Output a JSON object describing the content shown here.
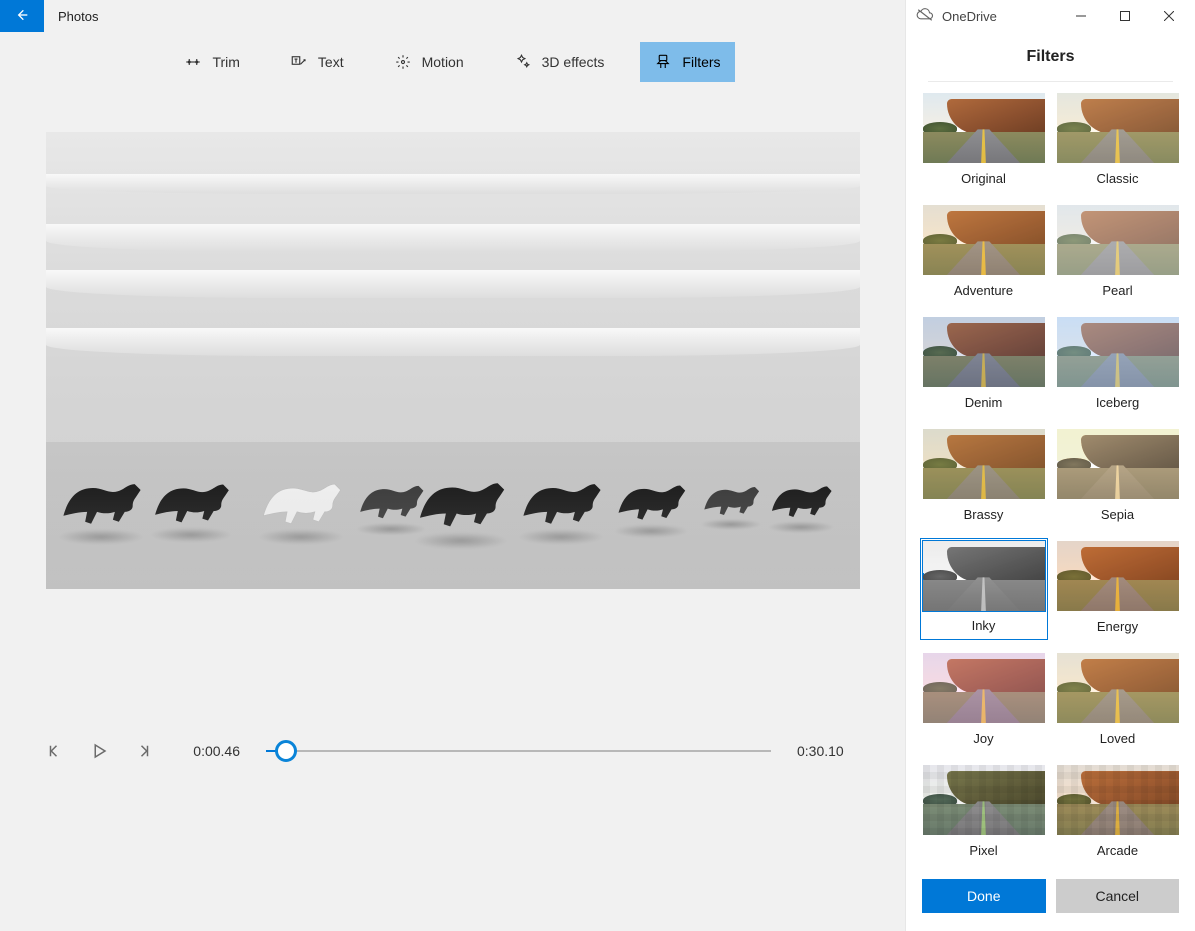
{
  "app": {
    "title": "Photos"
  },
  "toolbar": {
    "items": [
      {
        "id": "trim",
        "label": "Trim"
      },
      {
        "id": "text",
        "label": "Text"
      },
      {
        "id": "motion",
        "label": "Motion"
      },
      {
        "id": "fx3d",
        "label": "3D effects"
      },
      {
        "id": "filters",
        "label": "Filters",
        "active": true
      }
    ]
  },
  "timeline": {
    "current": "0:00.46",
    "duration": "0:30.10",
    "progress_percent": 4
  },
  "onedrive": {
    "label": "OneDrive"
  },
  "filters_panel": {
    "title": "Filters",
    "selected": "inky",
    "items": [
      {
        "id": "original",
        "label": "Original"
      },
      {
        "id": "classic",
        "label": "Classic"
      },
      {
        "id": "adventure",
        "label": "Adventure"
      },
      {
        "id": "pearl",
        "label": "Pearl"
      },
      {
        "id": "denim",
        "label": "Denim"
      },
      {
        "id": "iceberg",
        "label": "Iceberg"
      },
      {
        "id": "brassy",
        "label": "Brassy"
      },
      {
        "id": "sepia",
        "label": "Sepia"
      },
      {
        "id": "inky",
        "label": "Inky"
      },
      {
        "id": "energy",
        "label": "Energy"
      },
      {
        "id": "joy",
        "label": "Joy"
      },
      {
        "id": "loved",
        "label": "Loved"
      },
      {
        "id": "pixel",
        "label": "Pixel"
      },
      {
        "id": "arcade",
        "label": "Arcade"
      }
    ]
  },
  "buttons": {
    "done": "Done",
    "cancel": "Cancel"
  },
  "colors": {
    "accent": "#0078d7",
    "toolbar_active": "#7ebcea"
  }
}
